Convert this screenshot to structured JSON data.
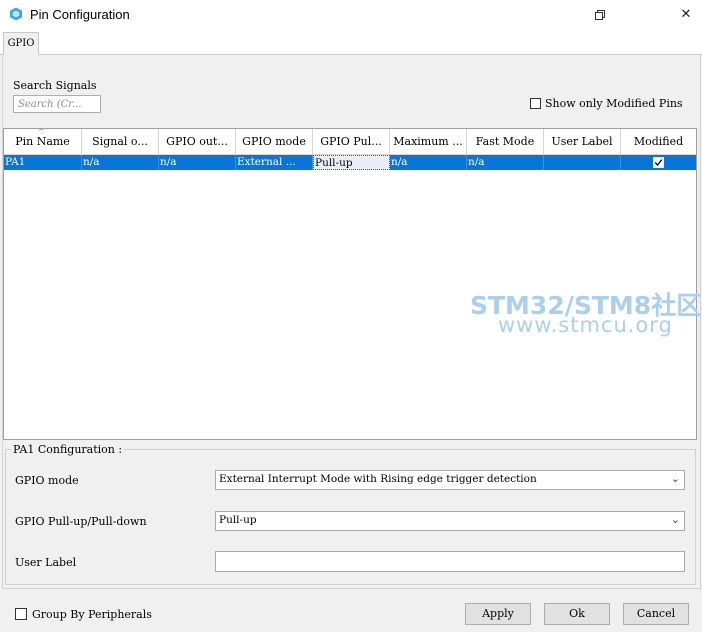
{
  "window": {
    "title": "Pin Configuration",
    "restore_icon": "restore-window-icon",
    "close_icon": "close-icon",
    "close_glyph": "✕"
  },
  "tabs": [
    {
      "label": "GPIO"
    }
  ],
  "search": {
    "label": "Search Signals",
    "placeholder": "Search (Cr...",
    "value": ""
  },
  "show_only_modified": {
    "label": "Show only Modified Pins",
    "checked": false
  },
  "table": {
    "columns": [
      "Pin Name",
      "Signal o...",
      "GPIO out...",
      "GPIO mode",
      "GPIO Pul...",
      "Maximum ...",
      "Fast Mode",
      "User Label",
      "Modified"
    ],
    "sort_column": "Pin Name",
    "rows": [
      {
        "pin_name": "PA1",
        "signal": "n/a",
        "gpio_output": "n/a",
        "gpio_mode": "External ...",
        "gpio_pull": "Pull-up",
        "maximum": "n/a",
        "fast_mode": "n/a",
        "user_label": "",
        "modified": true,
        "selected": true
      }
    ]
  },
  "watermark": {
    "line1": "STM32/STM8社区",
    "line2": "www.stmcu.org"
  },
  "config": {
    "group_title": "PA1 Configuration :",
    "gpio_mode_label": "GPIO mode",
    "gpio_mode_value": "External Interrupt Mode with Rising edge trigger detection",
    "pull_label": "GPIO Pull-up/Pull-down",
    "pull_value": "Pull-up",
    "user_label_label": "User Label",
    "user_label_value": ""
  },
  "footer": {
    "group_by_label": "Group By Peripherals",
    "group_by_checked": false,
    "apply_label": "Apply",
    "ok_label": "Ok",
    "cancel_label": "Cancel"
  },
  "colors": {
    "selection": "#0a75d8",
    "watermark": "#a9d0ee",
    "app_icon": "#3da3e8"
  }
}
